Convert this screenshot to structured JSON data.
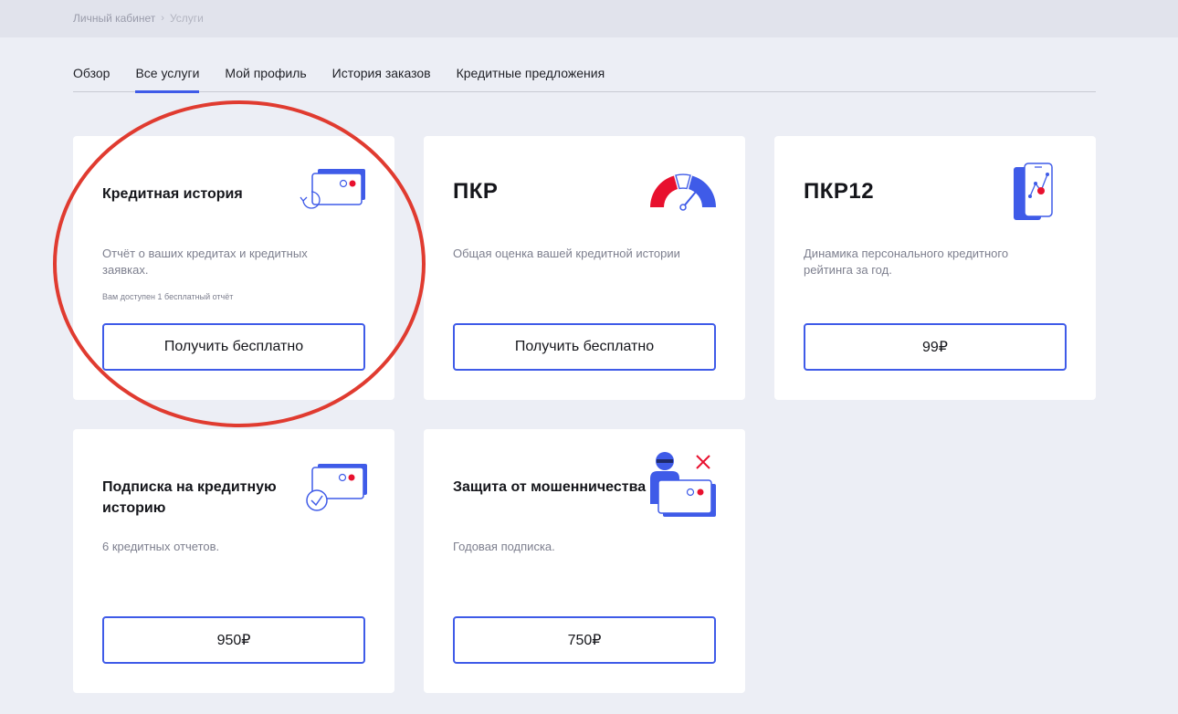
{
  "breadcrumb": {
    "home": "Личный кабинет",
    "separator": "›",
    "current": "Услуги"
  },
  "tabs": [
    {
      "label": "Обзор",
      "active": false
    },
    {
      "label": "Все услуги",
      "active": true
    },
    {
      "label": "Мой профиль",
      "active": false
    },
    {
      "label": "История заказов",
      "active": false
    },
    {
      "label": "Кредитные предложения",
      "active": false
    }
  ],
  "cards": [
    {
      "title": "Кредитная история",
      "description": "Отчёт о ваших кредитах и кредитных заявках.",
      "note": "Вам доступен 1 бесплатный отчёт",
      "button": "Получить бесплатно",
      "icon": "credit-history-icon"
    },
    {
      "title": "ПКР",
      "description": "Общая оценка вашей кредитной истории",
      "button": "Получить бесплатно",
      "icon": "gauge-icon"
    },
    {
      "title": "ПКР12",
      "description": "Динамика персонального кредитного рейтинга за год.",
      "button": "99₽",
      "icon": "phone-chart-icon"
    },
    {
      "title": "Подписка на кредитную историю",
      "description": "6 кредитных отчетов.",
      "button": "950₽",
      "icon": "subscription-check-icon"
    },
    {
      "title": "Защита от мошенничества",
      "description": "Годовая подписка.",
      "button": "750₽",
      "icon": "fraud-protection-icon"
    }
  ],
  "colors": {
    "accent": "#3f5be8",
    "danger": "#e8102e",
    "highlight": "#e03b30",
    "background": "#eceef5"
  }
}
